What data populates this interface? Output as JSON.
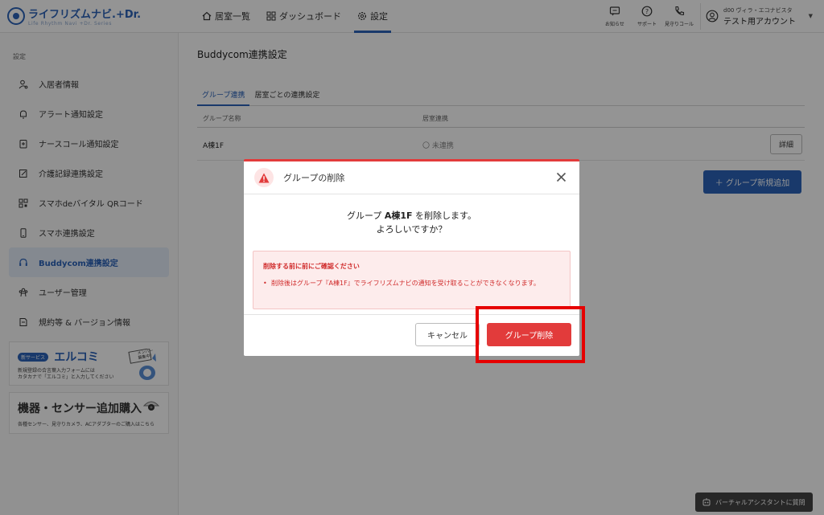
{
  "header": {
    "logo_title": "ライフリズムナビ.+Dr.",
    "logo_sub": "Life Rhythm Navi +Dr. Series",
    "nav": [
      {
        "label": "居室一覧",
        "icon": "home-icon"
      },
      {
        "label": "ダッシュボード",
        "icon": "dashboard-icon"
      },
      {
        "label": "設定",
        "icon": "gear-icon"
      }
    ],
    "utilities": [
      {
        "label": "お知らせ",
        "icon": "notice-icon"
      },
      {
        "label": "サポート",
        "icon": "help-icon"
      },
      {
        "label": "見守りコール",
        "icon": "phone-icon"
      }
    ],
    "account": {
      "facility": "d00 ヴィラ・エコナビスタ",
      "user": "テスト用アカウント"
    }
  },
  "sidebar": {
    "header": "設定",
    "items": [
      {
        "label": "入居者情報",
        "icon": "resident-icon"
      },
      {
        "label": "アラート通知設定",
        "icon": "bell-icon"
      },
      {
        "label": "ナースコール通知設定",
        "icon": "nurse-call-icon"
      },
      {
        "label": "介護記録連携設定",
        "icon": "care-record-icon"
      },
      {
        "label": "スマホdeバイタル QRコード",
        "icon": "qr-code-icon"
      },
      {
        "label": "スマホ連携設定",
        "icon": "smartphone-icon"
      },
      {
        "label": "Buddycom連携設定",
        "icon": "headset-icon"
      },
      {
        "label": "ユーザー管理",
        "icon": "users-icon"
      },
      {
        "label": "規約等 & バージョン情報",
        "icon": "document-icon"
      }
    ],
    "banner1": {
      "tag": "新サービス",
      "title": "エルコミ",
      "desc1": "新規登録の合言葉入力フォームには",
      "desc2": "カタカナで「エルコミ」と入力してください",
      "badge": "メンバー募集中！"
    },
    "banner2": {
      "title": "機器・センサー追加購入",
      "desc": "各種センサー、見守りカメラ、ACアダプターのご購入はこちら"
    }
  },
  "main": {
    "page_title": "Buddycom連携設定",
    "tabs": [
      "グループ連携",
      "居室ごとの連携設定"
    ],
    "columns": [
      "グループ名称",
      "居室連携"
    ],
    "rows": [
      {
        "name": "A棟1F",
        "status": "〇 未連携",
        "action": "詳細"
      }
    ],
    "add_button": "＋ グループ新規追加",
    "assistant_button": "バーチャルアシスタントに質問"
  },
  "dialog": {
    "title": "グループの削除",
    "message_pre": "グループ ",
    "group_name": "A棟1F",
    "message_post": " を削除します。",
    "message_line2": "よろしいですか？",
    "alert_title": "削除する前に前にご確認ください",
    "alert_message": "削除後はグループ『A棟1F』でライフリズムナビの通知を受け取ることができなくなります。",
    "cancel": "キャンセル",
    "confirm": "グループ削除"
  },
  "colors": {
    "accent": "#2b63b8",
    "danger": "#e23b3b",
    "highlight": "#e60000"
  }
}
